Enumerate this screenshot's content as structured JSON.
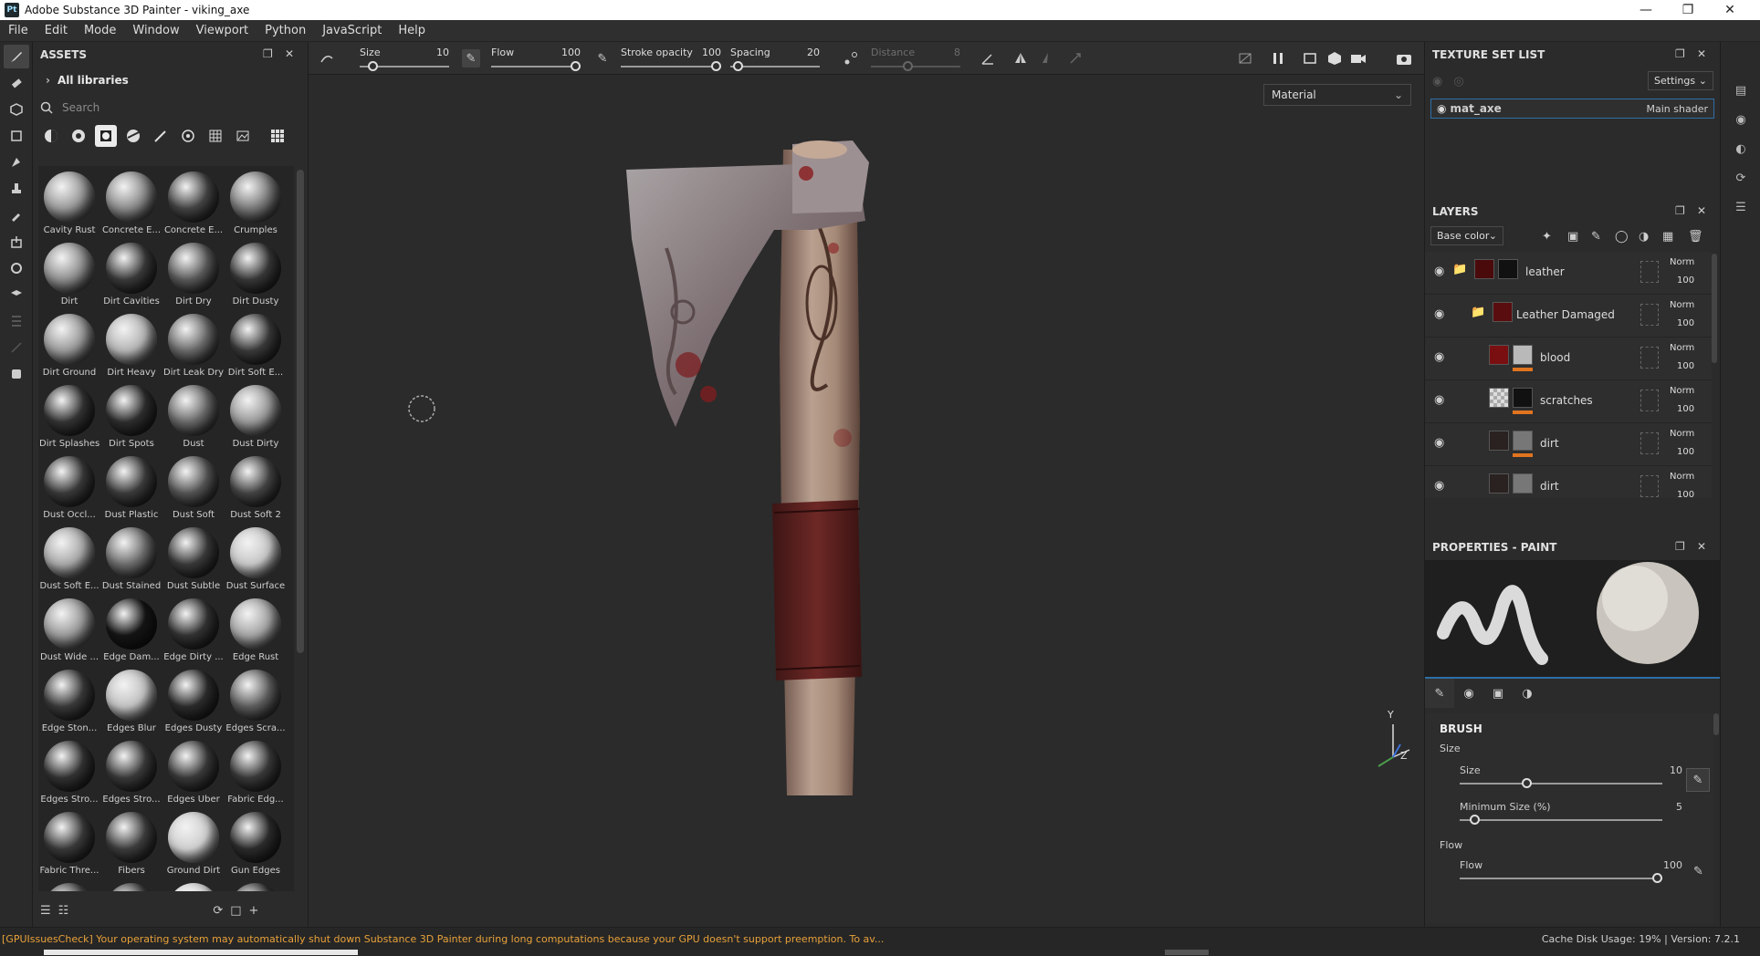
{
  "window": {
    "title": "Adobe Substance 3D Painter - viking_axe",
    "logo": "Pt"
  },
  "menu": [
    "File",
    "Edit",
    "Mode",
    "Window",
    "Viewport",
    "Python",
    "JavaScript",
    "Help"
  ],
  "assets": {
    "title": "ASSETS",
    "library": "All libraries",
    "search_placeholder": "Search",
    "items": [
      {
        "label": "Cavity Rust",
        "tone": "#9a9a9a"
      },
      {
        "label": "Concrete E...",
        "tone": "#8c8c8c"
      },
      {
        "label": "Concrete E...",
        "tone": "#444"
      },
      {
        "label": "Crumples",
        "tone": "#7a7a7a"
      },
      {
        "label": "Dirt",
        "tone": "#8f8f8f"
      },
      {
        "label": "Dirt Cavities",
        "tone": "#3a3a3a"
      },
      {
        "label": "Dirt Dry",
        "tone": "#5a5a5a"
      },
      {
        "label": "Dirt Dusty",
        "tone": "#383838"
      },
      {
        "label": "Dirt Ground",
        "tone": "#9a9a9a"
      },
      {
        "label": "Dirt Heavy",
        "tone": "#b5b5b5"
      },
      {
        "label": "Dirt Leak Dry",
        "tone": "#6a6a6a"
      },
      {
        "label": "Dirt Soft E...",
        "tone": "#3a3a3a"
      },
      {
        "label": "Dirt Splashes",
        "tone": "#343434"
      },
      {
        "label": "Dirt Spots",
        "tone": "#2e2e2e"
      },
      {
        "label": "Dust",
        "tone": "#6a6a6a"
      },
      {
        "label": "Dust Dirty",
        "tone": "#9a9a9a"
      },
      {
        "label": "Dust Occl...",
        "tone": "#3a3a3a"
      },
      {
        "label": "Dust Plastic",
        "tone": "#3c3c3c"
      },
      {
        "label": "Dust Soft",
        "tone": "#555"
      },
      {
        "label": "Dust Soft 2",
        "tone": "#444"
      },
      {
        "label": "Dust Soft E...",
        "tone": "#aaa"
      },
      {
        "label": "Dust Stained",
        "tone": "#6e6e6e"
      },
      {
        "label": "Dust Subtle",
        "tone": "#3a3a3a"
      },
      {
        "label": "Dust Surface",
        "tone": "#c8c8c8"
      },
      {
        "label": "Dust Wide ...",
        "tone": "#9a9a9a"
      },
      {
        "label": "Edge Dam...",
        "tone": "#151515"
      },
      {
        "label": "Edge Dirty ...",
        "tone": "#333"
      },
      {
        "label": "Edge Rust",
        "tone": "#a5a5a5"
      },
      {
        "label": "Edge Ston...",
        "tone": "#3a3a3a"
      },
      {
        "label": "Edges Blur",
        "tone": "#c2c2c2"
      },
      {
        "label": "Edges Dusty",
        "tone": "#2c2c2c"
      },
      {
        "label": "Edges Scra...",
        "tone": "#5e5e5e"
      },
      {
        "label": "Edges Stro...",
        "tone": "#333"
      },
      {
        "label": "Edges Stro...",
        "tone": "#3a3a3a"
      },
      {
        "label": "Edges Uber",
        "tone": "#3a3a3a"
      },
      {
        "label": "Fabric Edg...",
        "tone": "#3a3a3a"
      },
      {
        "label": "Fabric Thre...",
        "tone": "#3a3a3a"
      },
      {
        "label": "Fibers",
        "tone": "#3e3e3e"
      },
      {
        "label": "Ground Dirt",
        "tone": "#d0d0d0"
      },
      {
        "label": "Gun Edges",
        "tone": "#2c2c2c"
      },
      {
        "label": "",
        "tone": "#444"
      },
      {
        "label": "",
        "tone": "#3a3a3a"
      },
      {
        "label": "",
        "tone": "#ddd"
      },
      {
        "label": "",
        "tone": "#333"
      }
    ]
  },
  "toolbar": {
    "size": {
      "label": "Size",
      "value": "10",
      "fraction": 0.1
    },
    "flow": {
      "label": "Flow",
      "value": "100",
      "fraction": 1.0
    },
    "stroke_opacity": {
      "label": "Stroke opacity",
      "value": "100",
      "fraction": 1.0
    },
    "spacing": {
      "label": "Spacing",
      "value": "20",
      "fraction": 0.03
    },
    "distance": {
      "label": "Distance",
      "value": "8",
      "fraction": 0.4
    }
  },
  "viewport": {
    "material_mode": "Material",
    "axis_y": "Y",
    "axis_z": "Z"
  },
  "texture_set_list": {
    "title": "TEXTURE SET LIST",
    "settings": "Settings",
    "set_name": "mat_axe",
    "shader": "Main shader"
  },
  "layers": {
    "title": "LAYERS",
    "channel": "Base color",
    "items": [
      {
        "name": "leather",
        "blend": "Norm",
        "opacity": "100"
      },
      {
        "name": "Leather Damaged",
        "blend": "Norm",
        "opacity": "100"
      },
      {
        "name": "blood",
        "blend": "Norm",
        "opacity": "100"
      },
      {
        "name": "scratches",
        "blend": "Norm",
        "opacity": "100"
      },
      {
        "name": "dirt",
        "blend": "Norm",
        "opacity": "100"
      },
      {
        "name": "dirt",
        "blend": "Norm",
        "opacity": "100"
      }
    ]
  },
  "properties": {
    "title": "PROPERTIES - PAINT",
    "section": "BRUSH",
    "size_group": "Size",
    "size_label": "Size",
    "size_value": "10",
    "size_fraction": 0.32,
    "min_size_label": "Minimum Size (%)",
    "min_size_value": "5",
    "min_size_fraction": 0.05,
    "flow_group": "Flow",
    "flow_label": "Flow",
    "flow_value": "100",
    "flow_fraction": 1.0
  },
  "status": {
    "message": "[GPUIssuesCheck] Your operating system may automatically shut down Substance 3D Painter during long computations because your GPU doesn't support preemption. To av...",
    "cache": "Cache Disk Usage:",
    "cache_value": "19%",
    "version": "Version: 7.2.1"
  }
}
